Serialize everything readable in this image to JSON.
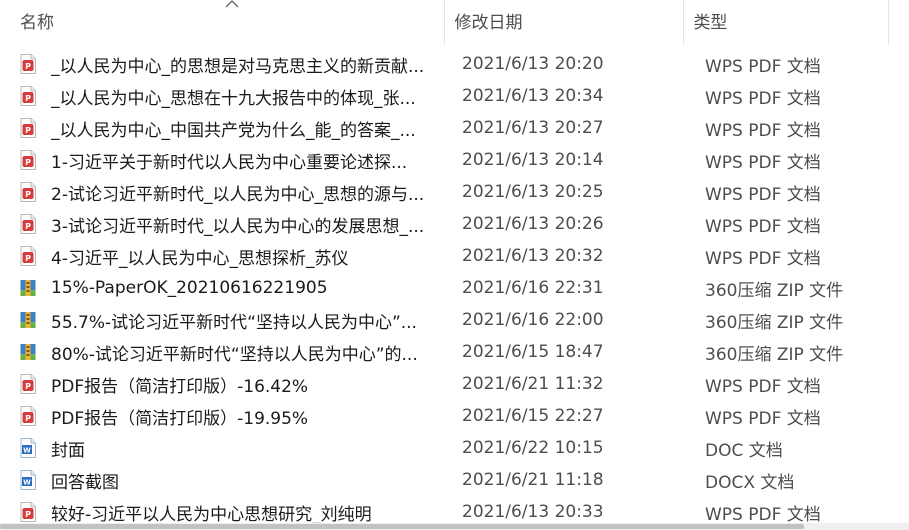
{
  "columns": {
    "name": "名称",
    "date": "修改日期",
    "type": "类型"
  },
  "files": [
    {
      "name": "_以人民为中心_的思想是对马克思主义的新贡献...",
      "date": "2021/6/13 20:20",
      "type": "WPS PDF 文档",
      "icon": "pdf"
    },
    {
      "name": "_以人民为中心_思想在十九大报告中的体现_张...",
      "date": "2021/6/13 20:34",
      "type": "WPS PDF 文档",
      "icon": "pdf"
    },
    {
      "name": "_以人民为中心_中国共产党为什么_能_的答案_...",
      "date": "2021/6/13 20:27",
      "type": "WPS PDF 文档",
      "icon": "pdf"
    },
    {
      "name": "1-习近平关于新时代以人民为中心重要论述探...",
      "date": "2021/6/13 20:14",
      "type": "WPS PDF 文档",
      "icon": "pdf"
    },
    {
      "name": "2-试论习近平新时代_以人民为中心_思想的源与...",
      "date": "2021/6/13 20:25",
      "type": "WPS PDF 文档",
      "icon": "pdf"
    },
    {
      "name": "3-试论习近平新时代_以人民为中心的发展思想_...",
      "date": "2021/6/13 20:26",
      "type": "WPS PDF 文档",
      "icon": "pdf"
    },
    {
      "name": "4-习近平_以人民为中心_思想探析_苏仪",
      "date": "2021/6/13 20:32",
      "type": "WPS PDF 文档",
      "icon": "pdf"
    },
    {
      "name": "15%-PaperOK_20210616221905",
      "date": "2021/6/16 22:31",
      "type": "360压缩 ZIP 文件",
      "icon": "zip"
    },
    {
      "name": "55.7%-试论习近平新时代“坚持以人民为中心”...",
      "date": "2021/6/16 22:00",
      "type": "360压缩 ZIP 文件",
      "icon": "zip"
    },
    {
      "name": "80%-试论习近平新时代“坚持以人民为中心”的...",
      "date": "2021/6/15 18:47",
      "type": "360压缩 ZIP 文件",
      "icon": "zip"
    },
    {
      "name": "PDF报告（简洁打印版）-16.42%",
      "date": "2021/6/21 11:32",
      "type": "WPS PDF 文档",
      "icon": "pdf"
    },
    {
      "name": "PDF报告（简洁打印版）-19.95%",
      "date": "2021/6/15 22:27",
      "type": "WPS PDF 文档",
      "icon": "pdf"
    },
    {
      "name": "封面",
      "date": "2021/6/22 10:15",
      "type": "DOC 文档",
      "icon": "doc"
    },
    {
      "name": "回答截图",
      "date": "2021/6/21 11:18",
      "type": "DOCX 文档",
      "icon": "docx"
    },
    {
      "name": "较好-习近平以人民为中心思想研究_刘纯明",
      "date": "2021/6/13 20:33",
      "type": "WPS PDF 文档",
      "icon": "pdf"
    }
  ],
  "colors": {
    "pdf": "#d63a3a",
    "zip_blue": "#3b82c4",
    "zip_green": "#6ab04c",
    "zip_yellow": "#f2b233",
    "word": "#2f6fc3"
  }
}
